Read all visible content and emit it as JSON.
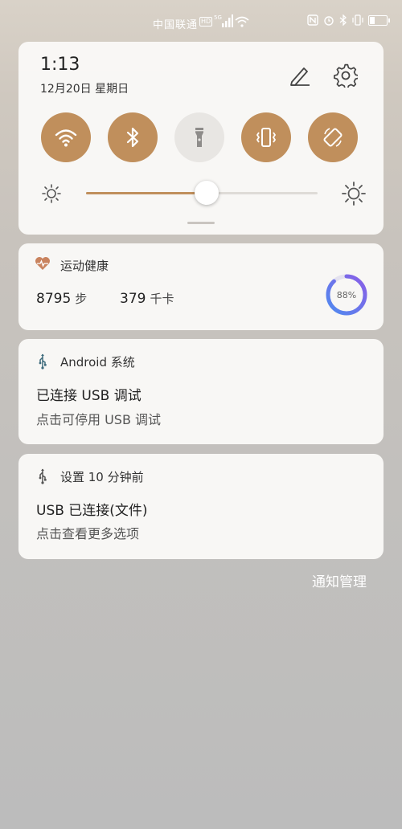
{
  "status_bar": {
    "carrier": "中国联通",
    "network_badge": "HD",
    "icons": [
      "nfc-icon",
      "alarm-icon",
      "bluetooth-icon",
      "vibrate-icon",
      "battery-icon"
    ]
  },
  "quick_settings": {
    "time": "1:13",
    "date": "12月20日 星期日",
    "toggles": [
      {
        "name": "wifi",
        "on": true
      },
      {
        "name": "bluetooth",
        "on": true
      },
      {
        "name": "flashlight",
        "on": false
      },
      {
        "name": "vibrate",
        "on": true
      },
      {
        "name": "auto-rotate",
        "on": true
      }
    ],
    "brightness": 0.52,
    "accent": "#c08f5c"
  },
  "health": {
    "app_name": "运动健康",
    "steps": "8795",
    "steps_unit": "步",
    "kcal": "379",
    "kcal_unit": "千卡",
    "progress_text": "88%",
    "progress": 0.88
  },
  "notifications": [
    {
      "app": "Android 系统",
      "title": "已连接 USB 调试",
      "body": "点击可停用 USB 调试"
    },
    {
      "app": "设置 10 分钟前",
      "title": "USB 已连接(文件)",
      "body": "点击查看更多选项"
    }
  ],
  "manage_label": "通知管理"
}
